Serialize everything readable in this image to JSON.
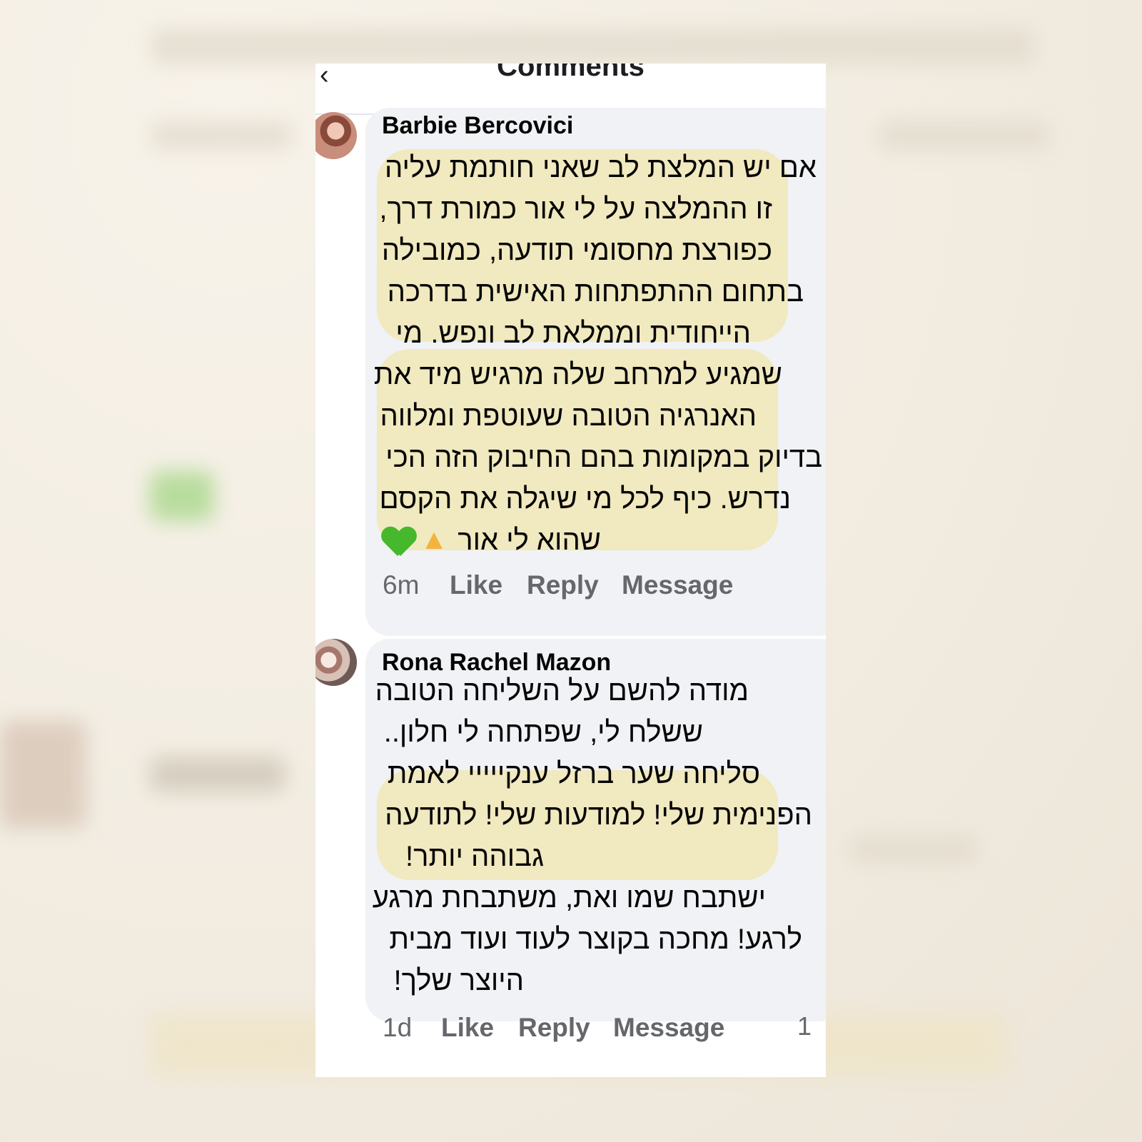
{
  "header": {
    "title": "Comments",
    "back_icon": "chevron-left-icon"
  },
  "comments": [
    {
      "author": "Barbie Bercovici",
      "lines": [
        "אם יש המלצת לב שאני חותמת עליה",
        "זו ההמלצה על לי אור כמורת דרך,",
        "כפורצת מחסומי תודעה, כמובילה",
        "בתחום ההתפתחות האישית בדרכה",
        "הייחודית וממלאת לב ונפש. מי",
        "שמגיע למרחב שלה מרגיש מיד את",
        "האנרגיה הטובה שעוטפת ומלווה",
        "בדיוק במקומות בהם החיבוק הזה הכי",
        "נדרש. כיף לכל מי שיגלה את הקסם",
        "שהוא לי אור"
      ],
      "emojis": [
        "folded-hands-emoji",
        "green-heart-emoji"
      ],
      "time": "6m",
      "like": "Like",
      "reply": "Reply",
      "message": "Message"
    },
    {
      "author": "Rona Rachel Mazon",
      "lines": [
        "מודה להשם על השליחה הטובה",
        "ששלח לי, שפתחה לי חלון..",
        "סליחה שער ברזל ענקייייי לאמת",
        "הפנימית שלי! למודעות שלי! לתודעה",
        "גבוהה יותר!",
        "ישתבח שמו ואת, משתבחת מרגע",
        "לרגע! מחכה בקוצר לעוד ועוד מבית",
        "היוצר שלך!"
      ],
      "time": "1d",
      "like": "Like",
      "reply": "Reply",
      "message": "Message",
      "reaction_count": "1"
    }
  ],
  "colors": {
    "highlight": "#f1e9bf",
    "bubble": "#f0f2f5",
    "meta_text": "#65676b"
  }
}
